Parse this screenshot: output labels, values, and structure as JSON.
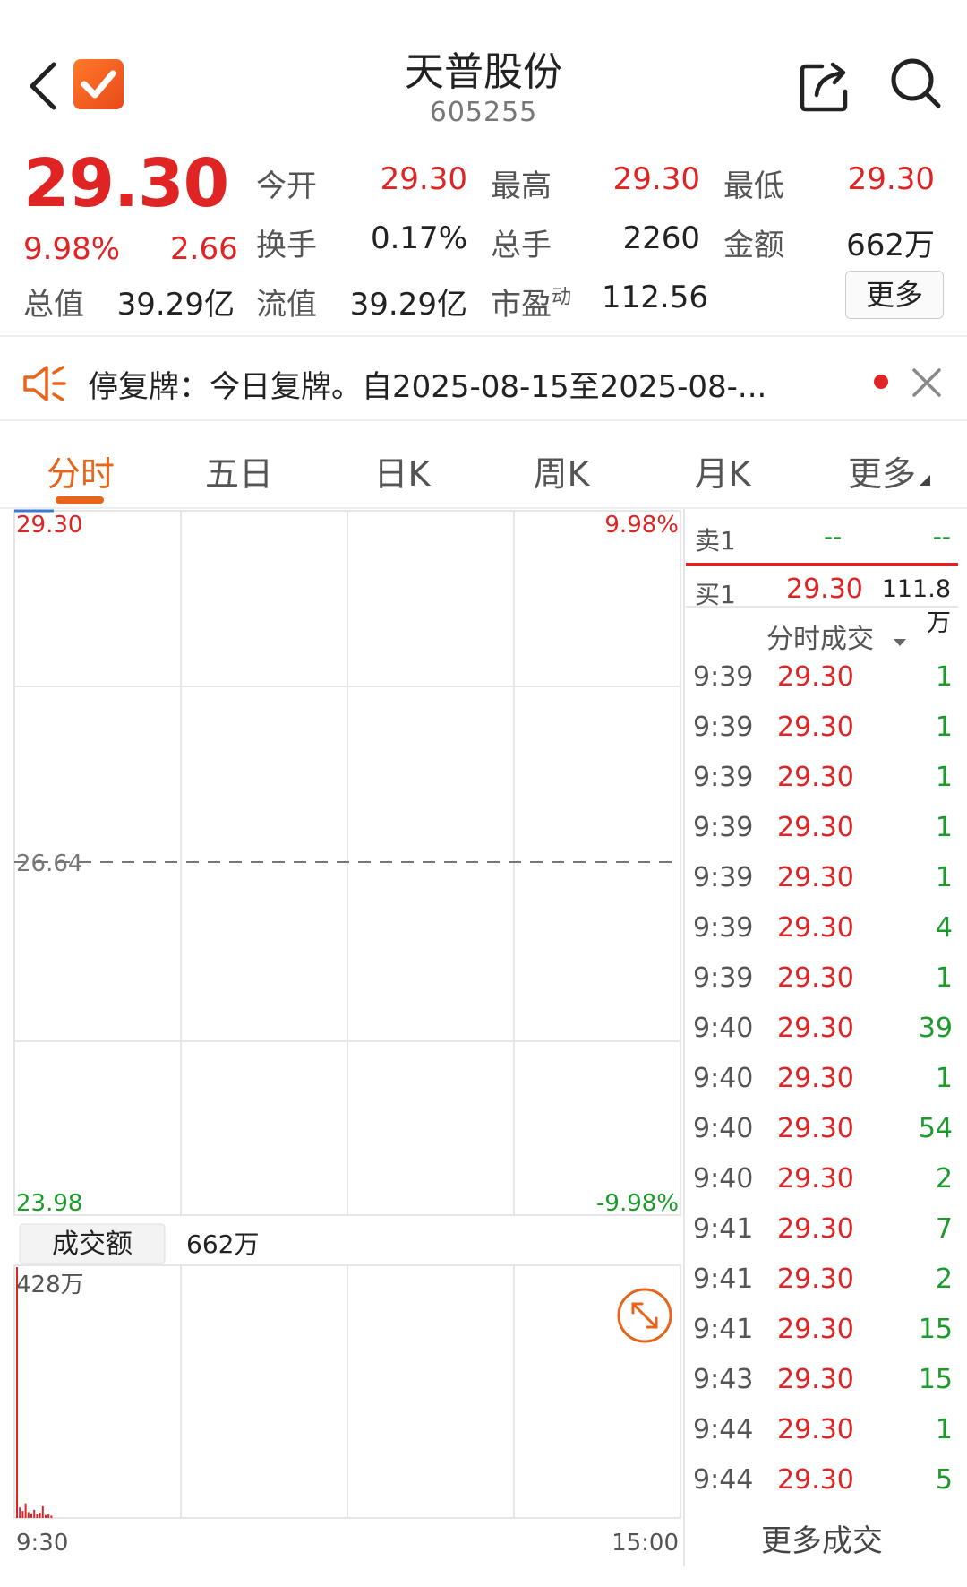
{
  "header": {
    "title": "天普股份",
    "code": "605255"
  },
  "quote": {
    "price": "29.30",
    "change_pct": "9.98%",
    "change": "2.66",
    "fields": [
      {
        "label": "今开",
        "value": "29.30"
      },
      {
        "label": "最高",
        "value": "29.30"
      },
      {
        "label": "最低",
        "value": "29.30"
      },
      {
        "label": "换手",
        "value": "0.17%"
      },
      {
        "label": "总手",
        "value": "2260"
      },
      {
        "label": "金额",
        "value": "662万"
      },
      {
        "label": "总值",
        "value": "39.29亿"
      },
      {
        "label": "流值",
        "value": "39.29亿"
      },
      {
        "label": "市盈",
        "sup": "动",
        "value": "112.56"
      }
    ],
    "more_label": "更多"
  },
  "notice": {
    "text": "停复牌：今日复牌。自2025-08-15至2025-08-..."
  },
  "tabs": [
    {
      "label": "分时",
      "active": true
    },
    {
      "label": "五日"
    },
    {
      "label": "日K"
    },
    {
      "label": "周K"
    },
    {
      "label": "月K"
    },
    {
      "label": "更多"
    }
  ],
  "chart": {
    "price_top": "29.30",
    "pct_top": "9.98%",
    "price_mid": "26.64",
    "price_bottom": "23.98",
    "pct_bottom": "-9.98%",
    "volume_tab": "成交额",
    "volume_total": "662万",
    "volume_max_label": "428万",
    "time_start": "9:30",
    "time_end": "15:00"
  },
  "chart_data": {
    "type": "line",
    "x_range": [
      "9:30",
      "15:00"
    ],
    "ylim": [
      23.98,
      29.3
    ],
    "y_ref": 26.64,
    "pct_range": [
      "-9.98%",
      "9.98%"
    ],
    "series": [
      {
        "values": [
          29.3
        ]
      }
    ],
    "volume": {
      "type": "bar",
      "max": 428,
      "unit": "万",
      "values": [
        428,
        18,
        12,
        25,
        10,
        8,
        14,
        6,
        9,
        20,
        5,
        7,
        4
      ]
    }
  },
  "orderbook": {
    "sell1_label": "卖1",
    "sell1_price": "--",
    "sell1_vol": "--",
    "buy1_label": "买1",
    "buy1_price": "29.30",
    "buy1_vol": "111.8万",
    "ticks_header": "分时成交",
    "more_trades": "更多成交"
  },
  "trades": [
    {
      "time": "9:39",
      "price": "29.30",
      "vol": "1"
    },
    {
      "time": "9:39",
      "price": "29.30",
      "vol": "1"
    },
    {
      "time": "9:39",
      "price": "29.30",
      "vol": "1"
    },
    {
      "time": "9:39",
      "price": "29.30",
      "vol": "1"
    },
    {
      "time": "9:39",
      "price": "29.30",
      "vol": "1"
    },
    {
      "time": "9:39",
      "price": "29.30",
      "vol": "4"
    },
    {
      "time": "9:39",
      "price": "29.30",
      "vol": "1"
    },
    {
      "time": "9:40",
      "price": "29.30",
      "vol": "39"
    },
    {
      "time": "9:40",
      "price": "29.30",
      "vol": "1"
    },
    {
      "time": "9:40",
      "price": "29.30",
      "vol": "54"
    },
    {
      "time": "9:40",
      "price": "29.30",
      "vol": "2"
    },
    {
      "time": "9:41",
      "price": "29.30",
      "vol": "7"
    },
    {
      "time": "9:41",
      "price": "29.30",
      "vol": "2"
    },
    {
      "time": "9:41",
      "price": "29.30",
      "vol": "15"
    },
    {
      "time": "9:43",
      "price": "29.30",
      "vol": "15"
    },
    {
      "time": "9:44",
      "price": "29.30",
      "vol": "1"
    },
    {
      "time": "9:44",
      "price": "29.30",
      "vol": "5"
    }
  ],
  "colors": {
    "up": "#e02424",
    "down": "#1b9b2b",
    "accent": "#e8641a"
  }
}
